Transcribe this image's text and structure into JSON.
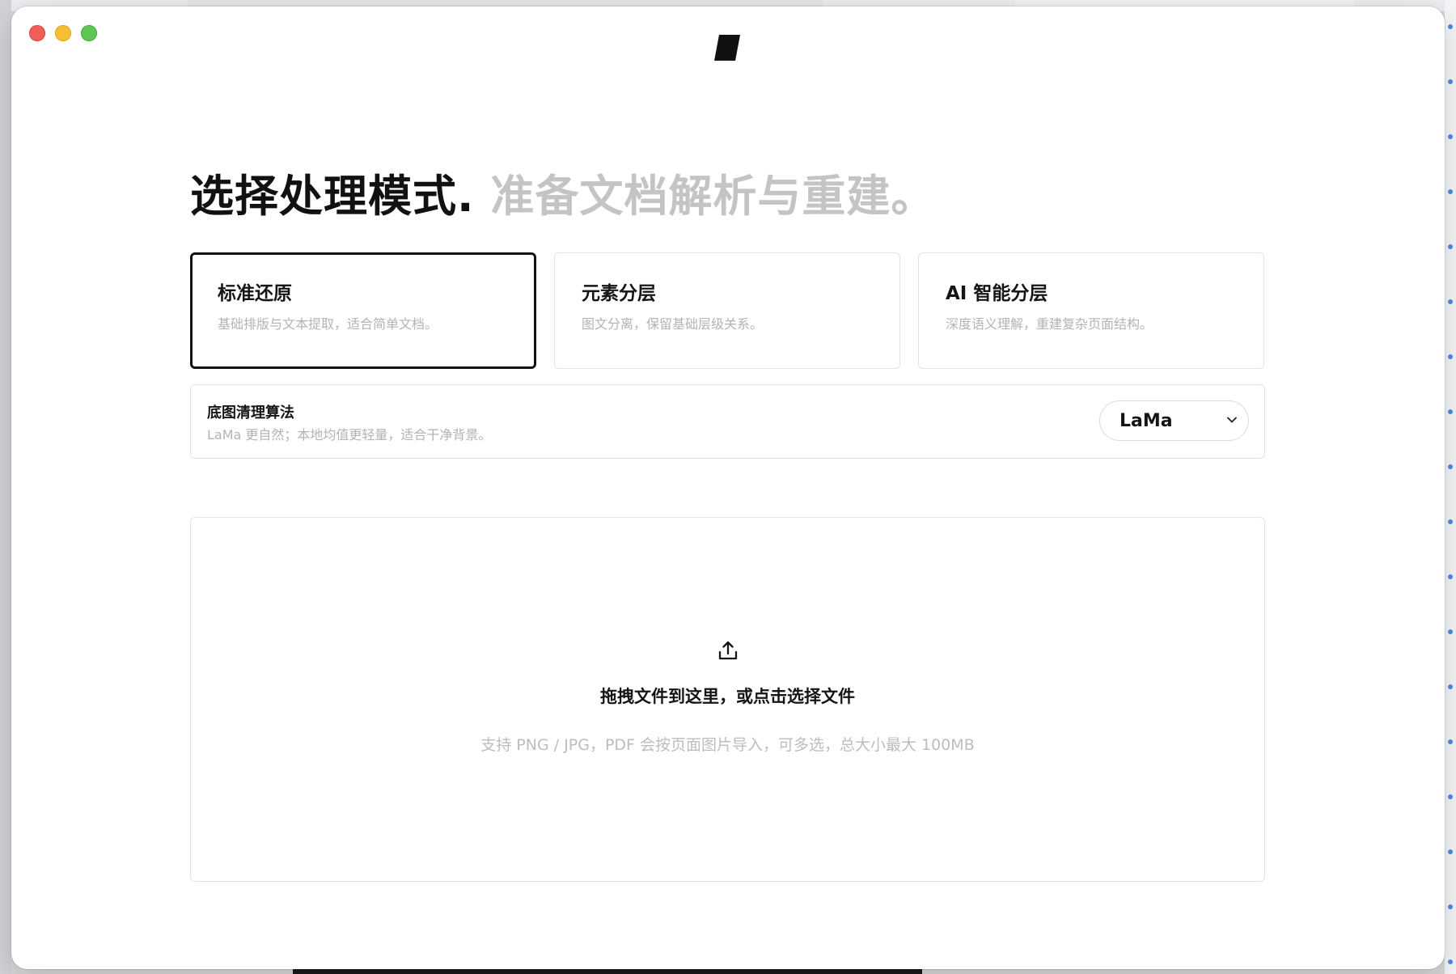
{
  "window": {
    "controls": [
      "close",
      "minimize",
      "maximize"
    ],
    "logo_icon": "parallelogram-logo-icon"
  },
  "headline": {
    "main": "选择处理模式.",
    "sub": "准备文档解析与重建。"
  },
  "modes": [
    {
      "title": "标准还原",
      "desc": "基础排版与文本提取，适合简单文档。",
      "selected": true
    },
    {
      "title": "元素分层",
      "desc": "图文分离，保留基础层级关系。",
      "selected": false
    },
    {
      "title": "AI 智能分层",
      "desc": "深度语义理解，重建复杂页面结构。",
      "selected": false
    }
  ],
  "algorithm": {
    "title": "底图清理算法",
    "desc": "LaMa 更自然；本地均值更轻量，适合干净背景。",
    "selected": "LaMa"
  },
  "dropzone": {
    "icon": "upload-icon",
    "primary": "拖拽文件到这里，或点击选择文件",
    "hint": "支持 PNG / JPG，PDF 会按页面图片导入，可多选，总大小最大 100MB"
  },
  "colors": {
    "close": "#ee5f58",
    "minimize": "#f5be33",
    "maximize": "#5fc554",
    "text_primary": "#151515",
    "text_muted": "#b3b3b3",
    "border": "#e3e3e3",
    "selected_border": "#111111"
  }
}
